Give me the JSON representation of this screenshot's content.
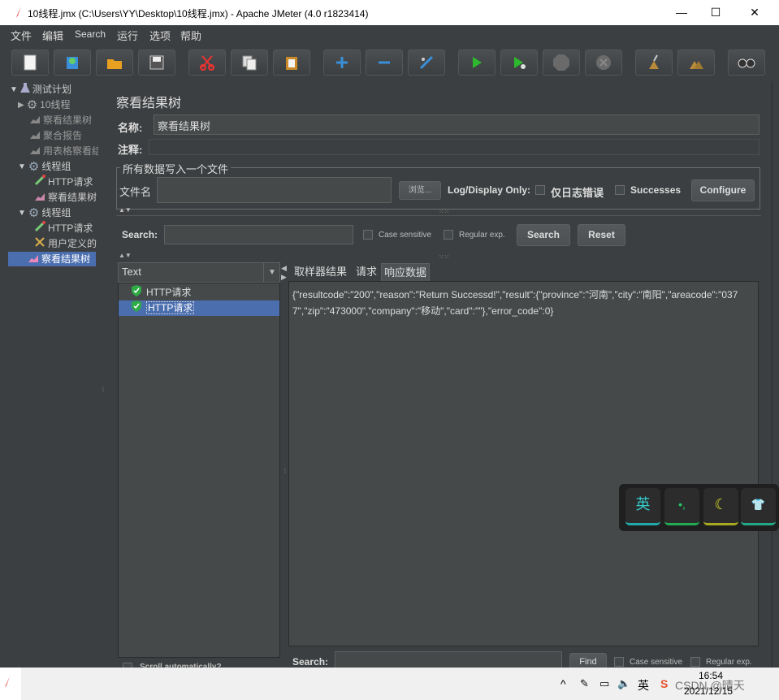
{
  "window": {
    "title": "10线程.jmx (C:\\Users\\YY\\Desktop\\10线程.jmx) - Apache JMeter (4.0 r1823414)",
    "minimize_glyph": "—",
    "maximize_glyph": "☐",
    "close_glyph": "✕"
  },
  "menubar": [
    "文件",
    "编辑",
    "Search",
    "运行",
    "选项",
    "帮助"
  ],
  "toolbar_icons": [
    "new-icon",
    "template-icon",
    "open-icon",
    "save-icon",
    "cut-icon",
    "copy-icon",
    "paste-icon",
    "expand-icon",
    "collapse-icon",
    "toggle-icon",
    "start-icon",
    "start-no-pause-icon",
    "stop-icon",
    "shutdown-icon",
    "clear-icon",
    "clear-all-icon",
    "search-icon"
  ],
  "tree": {
    "items": [
      {
        "label": "测试计划"
      },
      {
        "label": "10线程"
      },
      {
        "label": "察看结果树"
      },
      {
        "label": "聚合报告"
      },
      {
        "label": "用表格察看结"
      },
      {
        "label": "线程组"
      },
      {
        "label": "HTTP请求"
      },
      {
        "label": "察看结果树"
      },
      {
        "label": "线程组"
      },
      {
        "label": "HTTP请求"
      },
      {
        "label": "用户定义的"
      },
      {
        "label": "察看结果树"
      }
    ]
  },
  "panel": {
    "title": "察看结果树",
    "name_label": "名称:",
    "name_value": "察看结果树",
    "comment_label": "注释:",
    "comment_value": "",
    "file_group_title": "所有数据写入一个文件",
    "filename_label": "文件名",
    "filename_value": "",
    "browse_label": "浏览...",
    "log_display_label": "Log/Display Only:",
    "errors_only_label": "仅日志错误",
    "successes_label": "Successes",
    "configure_label": "Configure"
  },
  "search": {
    "label": "Search:",
    "value": "",
    "case_label": "Case sensitive",
    "regex_label": "Regular exp.",
    "search_button": "Search",
    "reset_button": "Reset"
  },
  "renderer": {
    "selected": "Text"
  },
  "samples": [
    {
      "label": "HTTP请求",
      "status": "success"
    },
    {
      "label": "HTTP请求",
      "status": "success"
    }
  ],
  "result_tabs": [
    "取样器结果",
    "请求",
    "响应数据"
  ],
  "active_tab": "响应数据",
  "response_body": "{\"resultcode\":\"200\",\"reason\":\"Return Successd!\",\"result\":{\"province\":\"河南\",\"city\":\"南阳\",\"areacode\":\"0377\",\"zip\":\"473000\",\"company\":\"移动\",\"card\":\"\"},\"error_code\":0}",
  "bottom_search": {
    "label": "Search:",
    "find_button": "Find",
    "case_label": "Case sensitive",
    "regex_label": "Regular exp."
  },
  "scroll_auto_label": "Scroll automatically?",
  "ime_toolbar": [
    "英",
    "•,",
    "☾",
    "👕"
  ],
  "taskbar": {
    "ime_label": "英",
    "time": "16:54",
    "date": "2021/12/15",
    "watermark": "CSDN @晴天"
  },
  "colors": {
    "bg": "#3c3f41",
    "field": "#45494a",
    "selection": "#4b6eaf",
    "success": "#2eaa47"
  }
}
